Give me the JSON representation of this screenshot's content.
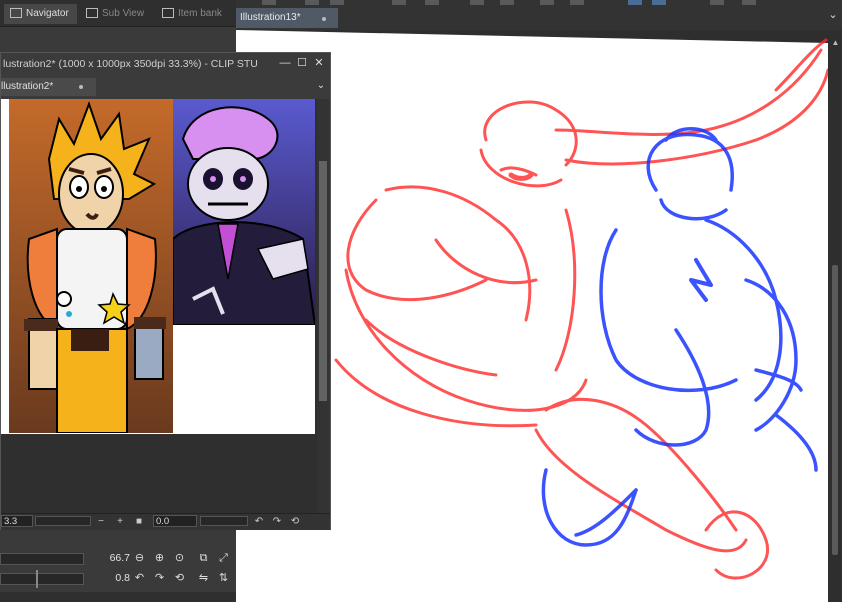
{
  "panel_tabs": [
    {
      "label": "Navigator",
      "icon": "navigator-icon",
      "active": true
    },
    {
      "label": "Sub View",
      "icon": "subview-icon",
      "active": false
    },
    {
      "label": "Item bank",
      "icon": "itembank-icon",
      "active": false
    }
  ],
  "canvas": {
    "tab_label": "Illustration13*",
    "unsaved_dot": "●",
    "chevron": "⌄"
  },
  "subview": {
    "title": "lustration2* (1000 x 1000px 350dpi 33.3%)  - CLIP STU",
    "tab_label": "llustration2*",
    "unsaved_dot": "●",
    "min": "—",
    "max": "☐",
    "close": "✕",
    "chevron": "⌄",
    "zoom_value": "3.3",
    "angle_value": "0.0",
    "btn_minus": "−",
    "btn_plus": "+",
    "btn_stop": "■"
  },
  "navigator": {
    "zoom_value": "66.7",
    "rotation_value": "0.8"
  },
  "colors": {
    "sketch_red": "#ff2a2a",
    "sketch_blue": "#1a36ff",
    "accent": "#4f5a66"
  }
}
